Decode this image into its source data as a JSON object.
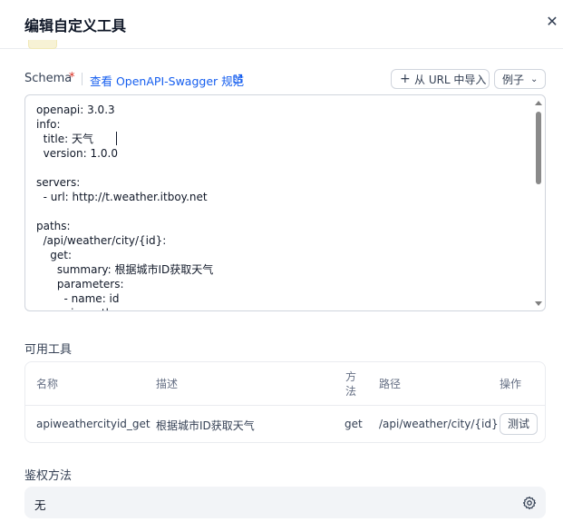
{
  "dialog": {
    "title": "编辑自定义工具",
    "close_glyph": "✕"
  },
  "schema": {
    "label": "Schema",
    "required_mark": "*",
    "swagger_link": "查看 OpenAPI-Swagger 规范",
    "import_button": "从 URL 中导入",
    "import_icon": "plus-icon",
    "example_button": "例子",
    "example_icon": "chevron-down-icon",
    "code": "openapi: 3.0.3\ninfo:\n  title: 天气\n  version: 1.0.0\n\nservers:\n  - url: http://t.weather.itboy.net\n\npaths:\n  /api/weather/city/{id}:\n    get:\n      summary: 根据城市ID获取天气\n      parameters:\n        - name: id\n          in: path"
  },
  "tools": {
    "section_label": "可用工具",
    "columns": {
      "name": "名称",
      "description": "描述",
      "method_line1": "方",
      "method_line2": "法",
      "path": "路径",
      "action": "操作"
    },
    "rows": [
      {
        "name": "apiweathercityid_get",
        "description": "根据城市ID获取天气",
        "method": "get",
        "path": "/api/weather/city/{id}",
        "action": "测试"
      }
    ]
  },
  "auth": {
    "section_label": "鉴权方法",
    "value": "无",
    "icon": "gear-icon"
  },
  "colors": {
    "link": "#155eef",
    "required": "#d92d20",
    "auth_bg": "#f2f4f7"
  }
}
